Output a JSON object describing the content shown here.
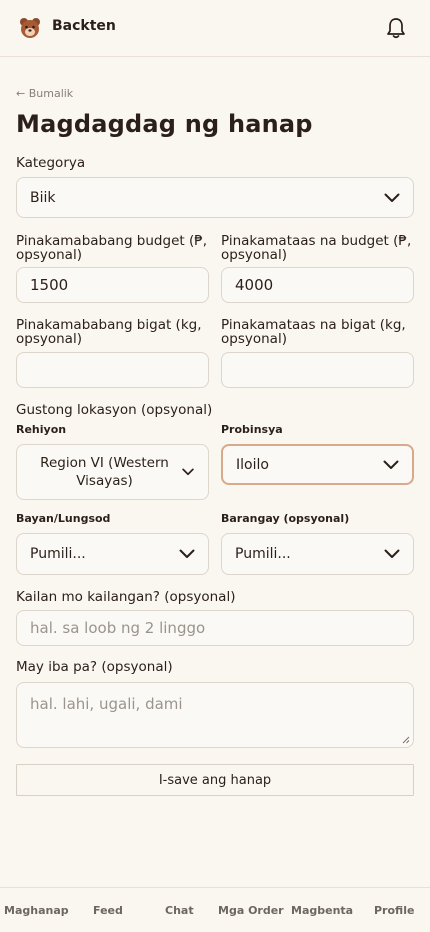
{
  "header": {
    "brand": "Backten",
    "logo_icon": "bear-face-icon",
    "notification_icon": "bell-icon"
  },
  "back_link": "← Bumalik",
  "page_title": "Magdagdag ng hanap",
  "form": {
    "category": {
      "label": "Kategorya",
      "value": "Biik"
    },
    "min_budget": {
      "label_line1": "Pinakamababang budget (₱,",
      "label_line2": "opsyonal)",
      "value": "1500"
    },
    "max_budget": {
      "label_line1": "Pinakamataas na budget (₱,",
      "label_line2": "opsyonal)",
      "value": "4000"
    },
    "min_weight": {
      "label_line1": "Pinakamababang bigat (kg,",
      "label_line2": "opsyonal)",
      "value": ""
    },
    "max_weight": {
      "label_line1": "Pinakamataas na bigat (kg,",
      "label_line2": "opsyonal)",
      "value": ""
    },
    "location": {
      "label": "Gustong lokasyon (opsyonal)",
      "region": {
        "label": "Rehiyon",
        "value_line1": "Region VI (Western",
        "value_line2": "Visayas)"
      },
      "province": {
        "label": "Probinsya",
        "value": "Iloilo"
      },
      "city": {
        "label": "Bayan/Lungsod",
        "value": "Pumili..."
      },
      "barangay": {
        "label": "Barangay (opsyonal)",
        "value": "Pumili..."
      }
    },
    "when_needed": {
      "label": "Kailan mo kailangan? (opsyonal)",
      "placeholder": "hal. sa loob ng 2 linggo"
    },
    "notes": {
      "label": "May iba pa? (opsyonal)",
      "placeholder": "hal. lahi, ugali, dami"
    },
    "save_label": "I-save ang hanap"
  },
  "bottom_nav": [
    "Maghanap",
    "Feed",
    "Chat",
    "Mga Order",
    "Magbenta",
    "Profile"
  ]
}
